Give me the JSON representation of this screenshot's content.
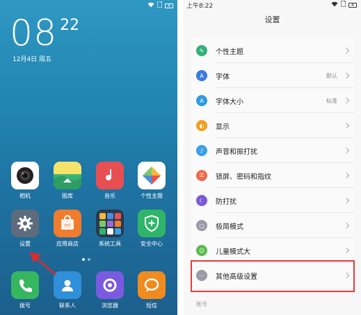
{
  "home": {
    "status": {
      "icons": [
        "wifi-icon",
        "sim-icon",
        "battery-icon"
      ],
      "battery": "4"
    },
    "clock": {
      "hours": "08",
      "minutes": "22"
    },
    "date": "12月4日 周五",
    "apps_row1": [
      {
        "label": "相机",
        "icon": "camera-icon",
        "color": "#ffffff"
      },
      {
        "label": "图库",
        "icon": "gallery-icon",
        "color": "#3cb878"
      },
      {
        "label": "音乐",
        "icon": "music-icon",
        "color": "#e84f52"
      },
      {
        "label": "个性主题",
        "icon": "theme-icon",
        "color": "#ffffff"
      }
    ],
    "apps_row2": [
      {
        "label": "设置",
        "icon": "gear-icon",
        "color": "#5d6b7d"
      },
      {
        "label": "应用商店",
        "icon": "store-icon",
        "color": "#f07c2e"
      },
      {
        "label": "系统工具",
        "icon": "folder-icon",
        "color": "#2a3a4c"
      },
      {
        "label": "安全中心",
        "icon": "shield-icon",
        "color": "#2fb56a"
      }
    ],
    "dock": [
      {
        "label": "拨号",
        "icon": "phone-icon",
        "color": "#36b65f"
      },
      {
        "label": "联系人",
        "icon": "contacts-icon",
        "color": "#2f8fd8"
      },
      {
        "label": "浏览器",
        "icon": "browser-icon",
        "color": "#7a5be0"
      },
      {
        "label": "短信",
        "icon": "sms-icon",
        "color": "#f08b1f"
      }
    ],
    "page_dots": 2,
    "active_dot": 0
  },
  "settings": {
    "status_time": "上午8:22",
    "title": "设置",
    "items": [
      {
        "label": "个性主题",
        "value": "",
        "icon": "theme-icon",
        "color": "#34b07a"
      },
      {
        "label": "字体",
        "value": "默认",
        "icon": "font-icon",
        "color": "#3a7be0"
      },
      {
        "label": "字体大小",
        "value": "标准",
        "icon": "font-size-icon",
        "color": "#2f9be0"
      },
      {
        "label": "显示",
        "value": "",
        "icon": "display-icon",
        "color": "#f0a020"
      },
      {
        "label": "声音和振打扰",
        "value": "",
        "icon": "sound-icon",
        "color": "#3aa0e8"
      },
      {
        "label": "锁屏、密码和指纹",
        "value": "",
        "icon": "lock-icon",
        "color": "#ee6b4a"
      },
      {
        "label": "防打扰",
        "value": "",
        "icon": "moon-icon",
        "color": "#7b59d6"
      },
      {
        "label": "极简模式",
        "value": "",
        "icon": "simple-mode-icon",
        "color": "#9a9aa6"
      },
      {
        "label": "儿童模式大",
        "value": "",
        "icon": "child-icon",
        "color": "#58b94c"
      },
      {
        "label": "其他高级设置",
        "value": "",
        "icon": "more-icon",
        "color": "#9a9aa6"
      }
    ],
    "footer_label": "账号",
    "highlight_color": "#e23b3b"
  }
}
